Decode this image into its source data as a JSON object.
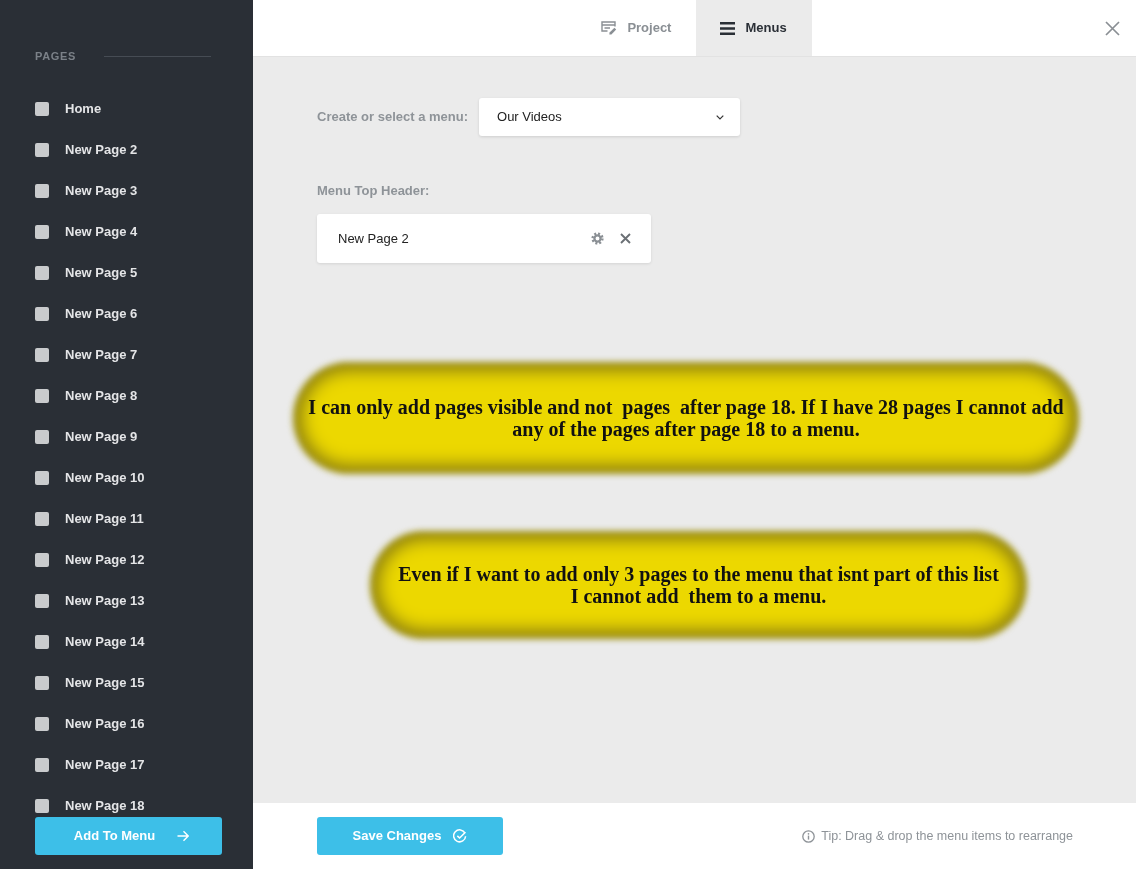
{
  "sidebar": {
    "heading": "PAGES",
    "pages": [
      {
        "label": "Home",
        "checked": false
      },
      {
        "label": "New Page 2",
        "checked": false
      },
      {
        "label": "New Page 3",
        "checked": false
      },
      {
        "label": "New Page 4",
        "checked": false
      },
      {
        "label": "New Page 5",
        "checked": false
      },
      {
        "label": "New Page 6",
        "checked": false
      },
      {
        "label": "New Page 7",
        "checked": false
      },
      {
        "label": "New Page 8",
        "checked": false
      },
      {
        "label": "New Page 9",
        "checked": false
      },
      {
        "label": "New Page 10",
        "checked": false
      },
      {
        "label": "New Page 11",
        "checked": false
      },
      {
        "label": "New Page 12",
        "checked": false
      },
      {
        "label": "New Page 13",
        "checked": false
      },
      {
        "label": "New Page 14",
        "checked": false
      },
      {
        "label": "New Page 15",
        "checked": false
      },
      {
        "label": "New Page 16",
        "checked": false
      },
      {
        "label": "New Page 17",
        "checked": false
      },
      {
        "label": "New Page 18",
        "checked": false
      }
    ],
    "add_button": "Add To Menu"
  },
  "tabs": [
    {
      "label": "Project",
      "selected": false
    },
    {
      "label": "Menus",
      "selected": true
    }
  ],
  "menu_picker": {
    "label": "Create or select a menu:",
    "value": "Our Videos"
  },
  "menu_top_header": {
    "label": "Menu Top Header:",
    "items": [
      {
        "label": "New Page 2"
      }
    ]
  },
  "annotations": [
    {
      "text": "I can only add pages visible and not  pages  after page 18. If I have 28 pages I cannot add any of the pages after page 18 to a menu."
    },
    {
      "text": "Even if I want to add only 3 pages to the menu that isnt part of this list I cannot add  them to a menu."
    }
  ],
  "footer": {
    "save_button": "Save Changes",
    "tip": "Tip: Drag & drop the menu items to rearrange"
  }
}
